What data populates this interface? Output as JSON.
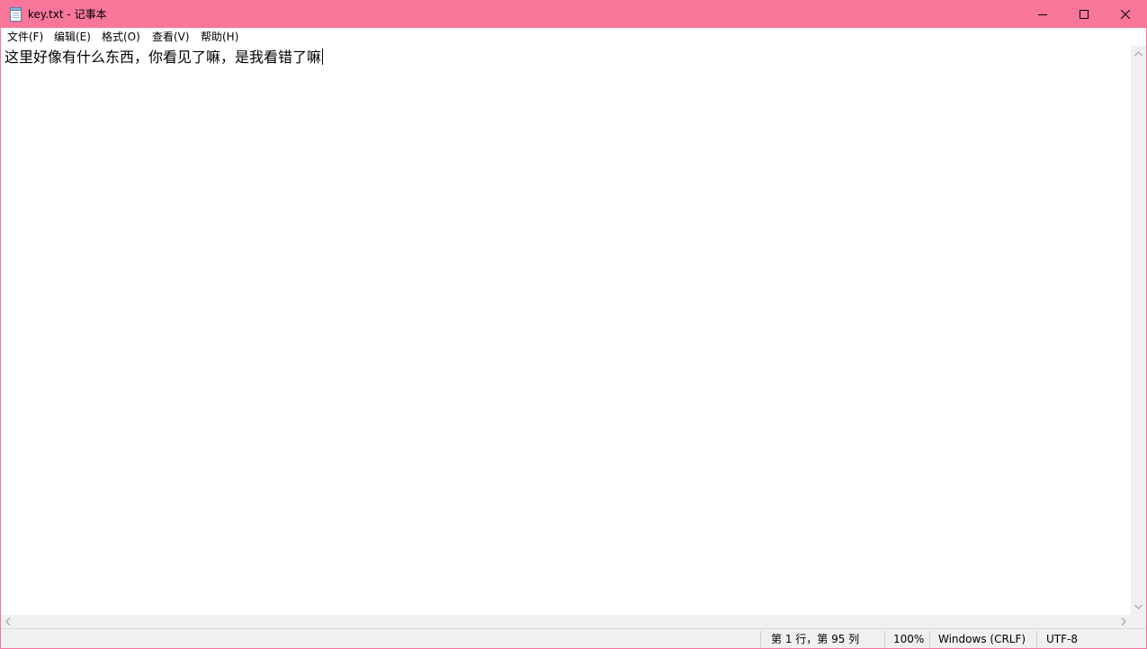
{
  "window": {
    "title": "key.txt - 记事本",
    "icon": "notepad-icon",
    "controls": {
      "minimize_icon": "minimize-icon",
      "maximize_icon": "maximize-icon",
      "close_icon": "close-icon"
    },
    "accent_color": "#f7769a"
  },
  "menu": {
    "items": [
      {
        "label": "文件(F)"
      },
      {
        "label": "编辑(E)"
      },
      {
        "label": "格式(O)"
      },
      {
        "label": "查看(V)"
      },
      {
        "label": "帮助(H)"
      }
    ]
  },
  "editor": {
    "content": "这里好像有什么东西，你看见了嘛，是我看错了嘛"
  },
  "statusbar": {
    "position": "第 1 行，第 95 列",
    "zoom": "100%",
    "line_ending": "Windows (CRLF)",
    "encoding": "UTF-8"
  }
}
